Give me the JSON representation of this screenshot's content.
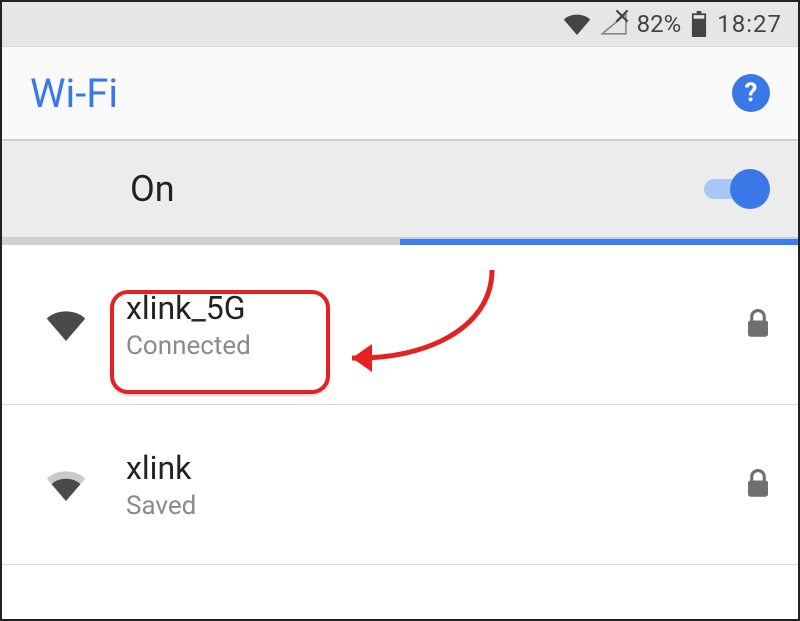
{
  "status_bar": {
    "battery_percent": "82%",
    "time": "18:27"
  },
  "header": {
    "title": "Wi-Fi"
  },
  "wifi_toggle": {
    "label": "On",
    "enabled": true
  },
  "networks": [
    {
      "ssid": "xlink_5G",
      "status": "Connected",
      "secured": true
    },
    {
      "ssid": "xlink",
      "status": "Saved",
      "secured": true
    }
  ],
  "annotation": {
    "highlights_network_index": 0
  }
}
